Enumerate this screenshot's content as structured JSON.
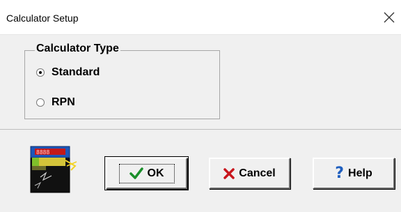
{
  "window": {
    "title": "Calculator Setup"
  },
  "groupbox": {
    "label": "Calculator Type",
    "options": [
      {
        "label": "Standard",
        "checked": true
      },
      {
        "label": "RPN",
        "checked": false
      }
    ]
  },
  "buttons": {
    "ok": "OK",
    "cancel": "Cancel",
    "help": "Help"
  },
  "icons": {
    "close": "close-icon",
    "ok": "checkmark-icon",
    "cancel": "x-icon",
    "help": "question-icon",
    "app": "calculator-icon"
  },
  "colors": {
    "checkmark": "#1a8f2a",
    "cancel_x": "#c8161d",
    "help": "#1f5fbf"
  }
}
